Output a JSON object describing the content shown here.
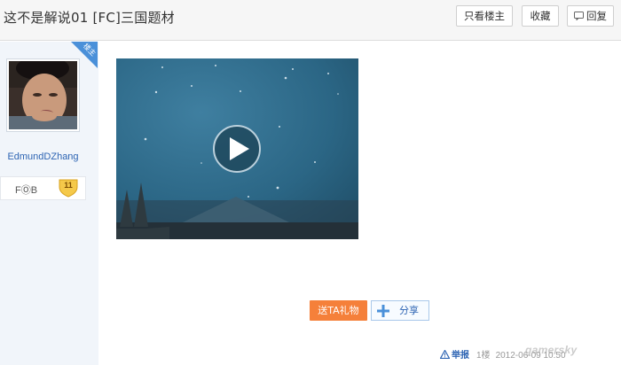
{
  "header": {
    "title": "这不是解说01 [FC]三国题材",
    "only_op_label": "只看楼主",
    "favorite_label": "收藏",
    "reply_label": "回复"
  },
  "author": {
    "op_badge": "楼主",
    "username": "EdmundDZhang",
    "level_name": "FⓄB",
    "level_number": "11"
  },
  "video": {
    "play_icon": "play-icon"
  },
  "actions": {
    "gift_label": "送TA礼物",
    "share_label": "分享"
  },
  "footer": {
    "report_label": "举报",
    "floor": "1楼",
    "date": "2012-06-09 10:50"
  },
  "watermark": "gamersky"
}
